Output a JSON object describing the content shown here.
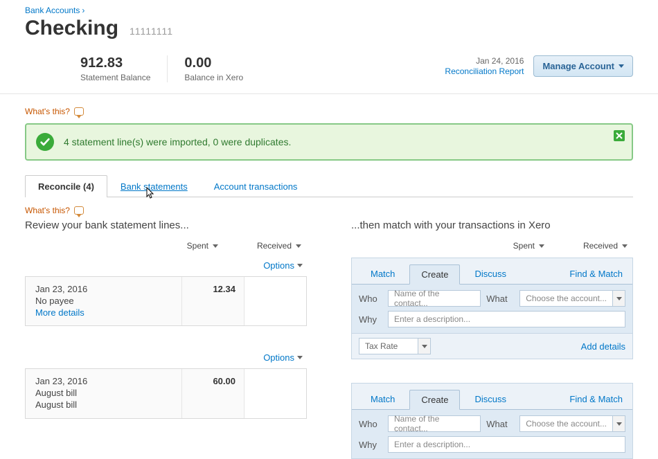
{
  "breadcrumb": {
    "parent": "Bank Accounts"
  },
  "header": {
    "title": "Checking",
    "account_number": "11111111"
  },
  "summary": {
    "statement_balance": {
      "value": "912.83",
      "label": "Statement Balance"
    },
    "balance_in_xero": {
      "value": "0.00",
      "label": "Balance in Xero"
    },
    "as_of_date": "Jan 24, 2016",
    "reconciliation_report": "Reconciliation Report",
    "manage_account": "Manage Account"
  },
  "whats_this": "What's this?",
  "alert": {
    "message": "4 statement line(s) were imported, 0 were duplicates."
  },
  "tabs": {
    "reconcile": "Reconcile (4)",
    "bank_statements": "Bank statements",
    "account_transactions": "Account transactions"
  },
  "left": {
    "title": "Review your bank statement lines...",
    "cols": {
      "spent": "Spent",
      "received": "Received"
    },
    "options": "Options",
    "items": [
      {
        "date": "Jan 23, 2016",
        "payee": "No payee",
        "desc": "",
        "more": "More details",
        "spent": "12.34",
        "received": ""
      },
      {
        "date": "Jan 23, 2016",
        "payee": "August bill",
        "desc": "August bill",
        "more": "",
        "spent": "60.00",
        "received": ""
      }
    ]
  },
  "right": {
    "title": "...then match with your transactions in Xero",
    "cols": {
      "spent": "Spent",
      "received": "Received"
    },
    "tab_match": "Match",
    "tab_create": "Create",
    "tab_discuss": "Discuss",
    "find_match": "Find & Match",
    "labels": {
      "who": "Who",
      "what": "What",
      "why": "Why"
    },
    "placeholders": {
      "who": "Name of the contact...",
      "what": "Choose the account...",
      "why": "Enter a description..."
    },
    "tax_rate": "Tax Rate",
    "add_details": "Add details"
  }
}
